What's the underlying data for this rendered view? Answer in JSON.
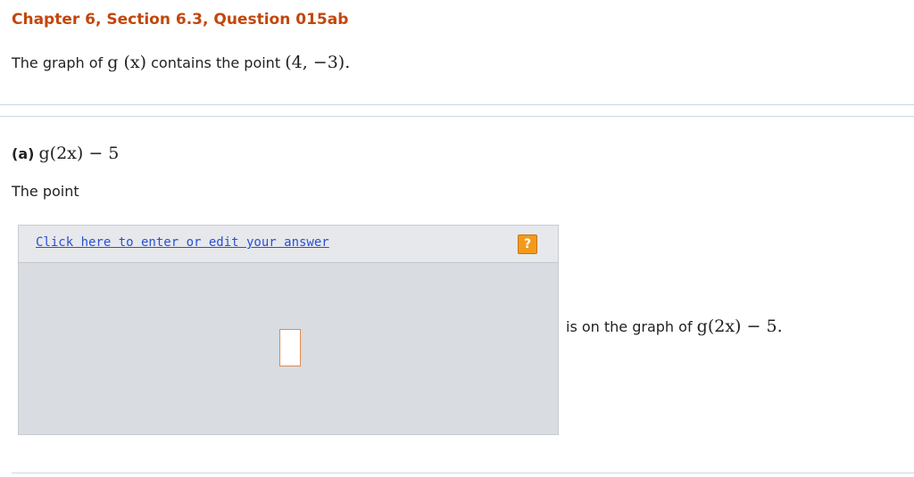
{
  "question": {
    "title": "Chapter 6, Section 6.3, Question 015ab",
    "intro_prefix": "The graph of",
    "intro_func": "g (x)",
    "intro_mid": "contains the point",
    "intro_point": "(4, −3)",
    "intro_suffix": "."
  },
  "part_a": {
    "label": "(a)",
    "expression": "g(2x) − 5",
    "prompt": "The point"
  },
  "answer_box": {
    "edit_link": "Click here to enter or edit your answer",
    "help_glyph": "?",
    "value": ""
  },
  "result": {
    "prefix": "is on the graph of",
    "expression": "g(2x) − 5",
    "suffix": "."
  },
  "colors": {
    "title": "#c2470c",
    "link": "#2a4fd6",
    "help_button": "#f19a1c",
    "answer_area": "#d9dce1"
  }
}
